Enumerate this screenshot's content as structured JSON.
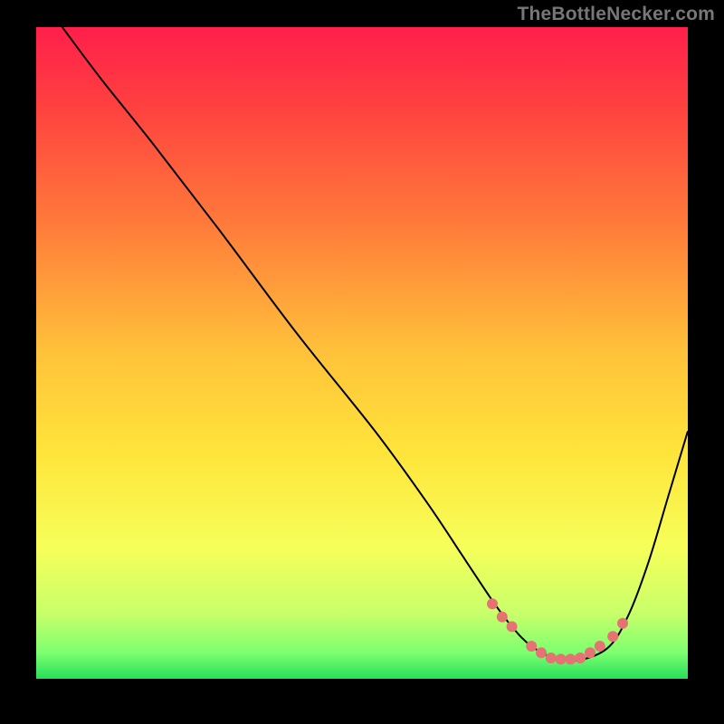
{
  "watermark": "TheBottleNecker.com",
  "chart_data": {
    "type": "line",
    "title": "",
    "xlabel": "",
    "ylabel": "",
    "xlim": [
      0,
      100
    ],
    "ylim": [
      0,
      100
    ],
    "gradient_stops": [
      {
        "offset": 0,
        "color": "#ff1f4b"
      },
      {
        "offset": 12,
        "color": "#ff4040"
      },
      {
        "offset": 30,
        "color": "#ff7a3a"
      },
      {
        "offset": 50,
        "color": "#ffc23a"
      },
      {
        "offset": 65,
        "color": "#ffe43a"
      },
      {
        "offset": 80,
        "color": "#f6ff5a"
      },
      {
        "offset": 90,
        "color": "#c8ff6a"
      },
      {
        "offset": 96,
        "color": "#7dff70"
      },
      {
        "offset": 100,
        "color": "#26e05a"
      }
    ],
    "series": [
      {
        "name": "bottleneck-curve",
        "stroke": "#000000",
        "x": [
          4,
          10,
          18,
          28,
          40,
          52,
          60,
          66,
          70,
          73,
          76,
          80,
          84,
          88,
          91,
          94,
          97,
          100
        ],
        "y": [
          100,
          92,
          82,
          69,
          53,
          38,
          27,
          18,
          12,
          8,
          5,
          3,
          3,
          5,
          10,
          18,
          28,
          38
        ]
      }
    ],
    "dots": {
      "color": "#e57373",
      "radius": 6,
      "points": [
        {
          "x": 70.0,
          "y": 11.5
        },
        {
          "x": 71.5,
          "y": 9.5
        },
        {
          "x": 73.0,
          "y": 8.0
        },
        {
          "x": 76.0,
          "y": 5.0
        },
        {
          "x": 77.5,
          "y": 4.0
        },
        {
          "x": 79.0,
          "y": 3.2
        },
        {
          "x": 80.5,
          "y": 3.0
        },
        {
          "x": 82.0,
          "y": 3.0
        },
        {
          "x": 83.5,
          "y": 3.2
        },
        {
          "x": 85.0,
          "y": 4.0
        },
        {
          "x": 86.5,
          "y": 5.0
        },
        {
          "x": 88.5,
          "y": 6.5
        },
        {
          "x": 90.0,
          "y": 8.5
        }
      ]
    }
  }
}
